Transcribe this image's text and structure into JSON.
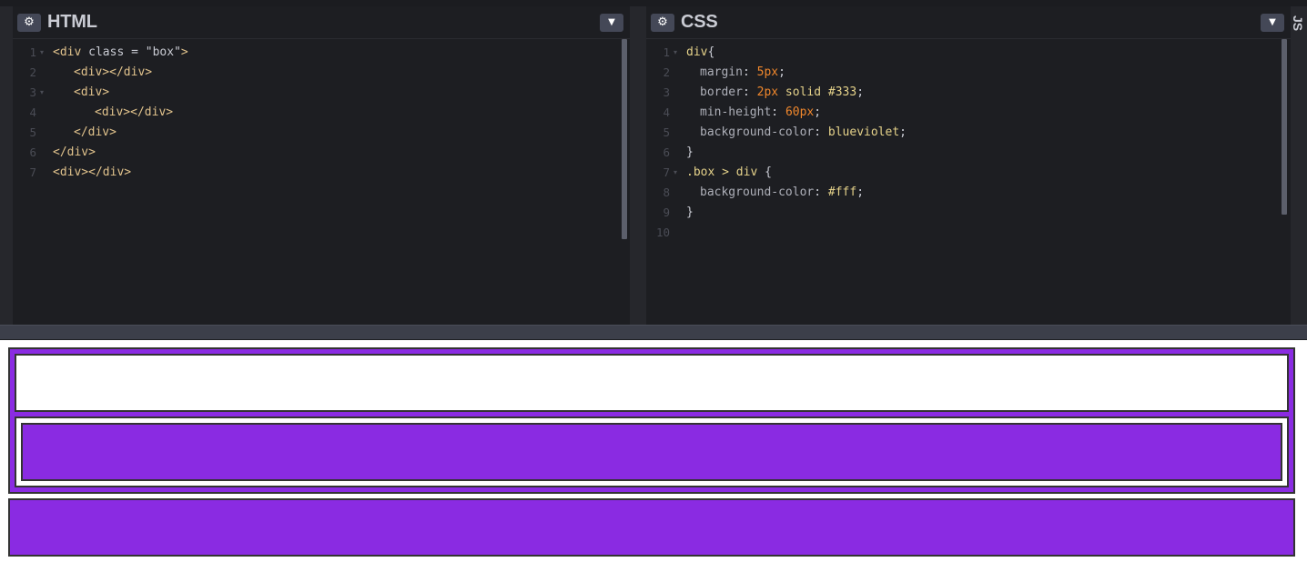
{
  "html_panel": {
    "title": "HTML",
    "settings_icon": "gear-icon",
    "collapse_icon": "chevron-down-icon",
    "lines": [
      {
        "n": "1",
        "fold": "▾",
        "tokens": [
          {
            "t": "<div ",
            "c": "tag"
          },
          {
            "t": "class",
            "c": "attr"
          },
          {
            "t": " = ",
            "c": "attr"
          },
          {
            "t": "\"box\"",
            "c": "str"
          },
          {
            "t": ">",
            "c": "tag"
          }
        ],
        "indent": 0
      },
      {
        "n": "2",
        "fold": "",
        "tokens": [
          {
            "t": "<div></div>",
            "c": "tag"
          }
        ],
        "indent": 1
      },
      {
        "n": "3",
        "fold": "▾",
        "tokens": [
          {
            "t": "<div>",
            "c": "tag"
          }
        ],
        "indent": 1
      },
      {
        "n": "4",
        "fold": "",
        "tokens": [
          {
            "t": "<div></div>",
            "c": "tag"
          }
        ],
        "indent": 2
      },
      {
        "n": "5",
        "fold": "",
        "tokens": [
          {
            "t": "</div>",
            "c": "tag"
          }
        ],
        "indent": 1
      },
      {
        "n": "6",
        "fold": "",
        "tokens": [
          {
            "t": "</div>",
            "c": "tag"
          }
        ],
        "indent": 0
      },
      {
        "n": "7",
        "fold": "",
        "tokens": [
          {
            "t": "<div></div>",
            "c": "tag"
          }
        ],
        "indent": 0
      }
    ]
  },
  "css_panel": {
    "title": "CSS",
    "settings_icon": "gear-icon",
    "collapse_icon": "chevron-down-icon",
    "lines": [
      {
        "n": "1",
        "fold": "▾",
        "tokens": [
          {
            "t": "div",
            "c": "sel"
          },
          {
            "t": "{",
            "c": "attr"
          }
        ],
        "indent": 0
      },
      {
        "n": "2",
        "fold": "",
        "tokens": [
          {
            "t": "margin",
            "c": "prop"
          },
          {
            "t": ": ",
            "c": "attr"
          },
          {
            "t": "5px",
            "c": "num"
          },
          {
            "t": ";",
            "c": "attr"
          }
        ],
        "indent": 1
      },
      {
        "n": "3",
        "fold": "",
        "tokens": [
          {
            "t": "border",
            "c": "prop"
          },
          {
            "t": ": ",
            "c": "attr"
          },
          {
            "t": "2px",
            "c": "num"
          },
          {
            "t": " solid #333",
            "c": "val"
          },
          {
            "t": ";",
            "c": "attr"
          }
        ],
        "indent": 1
      },
      {
        "n": "4",
        "fold": "",
        "tokens": [
          {
            "t": "min-height",
            "c": "prop"
          },
          {
            "t": ": ",
            "c": "attr"
          },
          {
            "t": "60px",
            "c": "num"
          },
          {
            "t": ";",
            "c": "attr"
          }
        ],
        "indent": 1
      },
      {
        "n": "5",
        "fold": "",
        "tokens": [
          {
            "t": "background-color",
            "c": "prop"
          },
          {
            "t": ": ",
            "c": "attr"
          },
          {
            "t": "blueviolet",
            "c": "val"
          },
          {
            "t": ";",
            "c": "attr"
          }
        ],
        "indent": 1
      },
      {
        "n": "6",
        "fold": "",
        "tokens": [
          {
            "t": "}",
            "c": "attr"
          }
        ],
        "indent": 0
      },
      {
        "n": "7",
        "fold": "▾",
        "tokens": [
          {
            "t": ".box > div",
            "c": "sel"
          },
          {
            "t": " {",
            "c": "attr"
          }
        ],
        "indent": 0
      },
      {
        "n": "8",
        "fold": "",
        "tokens": [
          {
            "t": "background-color",
            "c": "prop"
          },
          {
            "t": ": ",
            "c": "attr"
          },
          {
            "t": "#fff",
            "c": "val"
          },
          {
            "t": ";",
            "c": "attr"
          }
        ],
        "indent": 1
      },
      {
        "n": "9",
        "fold": "",
        "tokens": [
          {
            "t": "}",
            "c": "attr"
          }
        ],
        "indent": 0
      },
      {
        "n": "10",
        "fold": "",
        "tokens": [],
        "indent": 0
      }
    ]
  },
  "js_tab": {
    "label": "JS"
  },
  "colors": {
    "editor_bg": "#1d1e22",
    "preview_purple": "#8a2be2",
    "preview_white": "#ffffff",
    "preview_border": "#333333"
  }
}
